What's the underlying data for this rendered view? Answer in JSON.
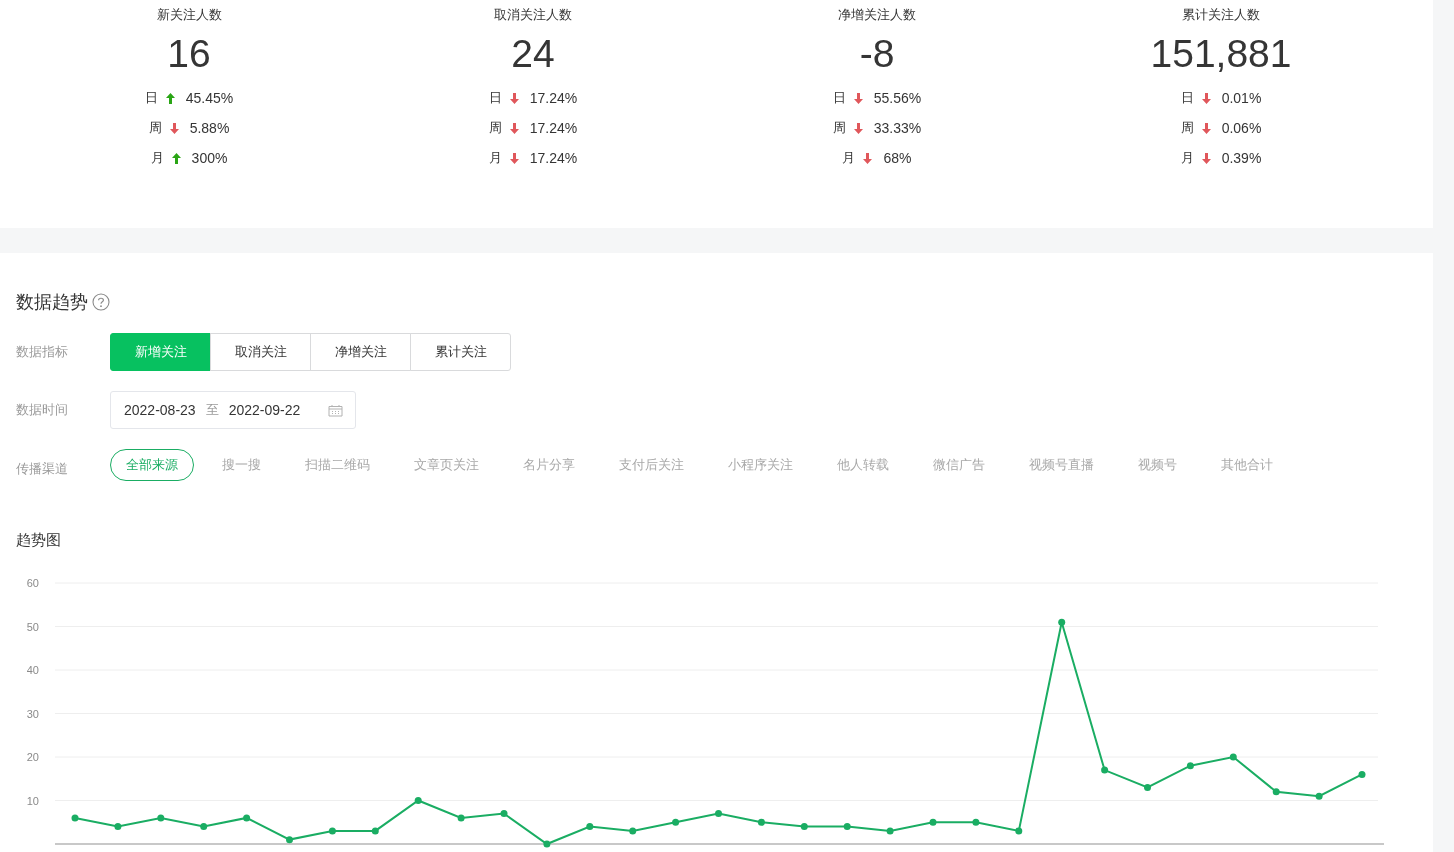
{
  "stats": [
    {
      "title": "新关注人数",
      "value": "16",
      "changes": [
        {
          "period": "日",
          "kind": "up",
          "percent": "45.45%"
        },
        {
          "period": "周",
          "kind": "down",
          "percent": "5.88%"
        },
        {
          "period": "月",
          "kind": "up",
          "percent": "300%"
        }
      ]
    },
    {
      "title": "取消关注人数",
      "value": "24",
      "changes": [
        {
          "period": "日",
          "kind": "down",
          "percent": "17.24%"
        },
        {
          "period": "周",
          "kind": "down",
          "percent": "17.24%"
        },
        {
          "period": "月",
          "kind": "down",
          "percent": "17.24%"
        }
      ]
    },
    {
      "title": "净增关注人数",
      "value": "-8",
      "changes": [
        {
          "period": "日",
          "kind": "down",
          "percent": "55.56%"
        },
        {
          "period": "周",
          "kind": "down",
          "percent": "33.33%"
        },
        {
          "period": "月",
          "kind": "down",
          "percent": "68%"
        }
      ]
    },
    {
      "title": "累计关注人数",
      "value": "151,881",
      "changes": [
        {
          "period": "日",
          "kind": "down",
          "percent": "0.01%"
        },
        {
          "period": "周",
          "kind": "down",
          "percent": "0.06%"
        },
        {
          "period": "月",
          "kind": "down",
          "percent": "0.39%"
        }
      ]
    }
  ],
  "trend": {
    "title": "数据趋势",
    "metric_label": "数据指标",
    "metrics": [
      {
        "label": "新增关注",
        "selected": true
      },
      {
        "label": "取消关注",
        "selected": false
      },
      {
        "label": "净增关注",
        "selected": false
      },
      {
        "label": "累计关注",
        "selected": false
      }
    ],
    "time_label": "数据时间",
    "date_range": {
      "start": "2022-08-23",
      "separator": "至",
      "end": "2022-09-22"
    },
    "channel_label": "传播渠道",
    "channels": [
      {
        "label": "全部来源",
        "selected": true
      },
      {
        "label": "搜一搜",
        "selected": false
      },
      {
        "label": "扫描二维码",
        "selected": false
      },
      {
        "label": "文章页关注",
        "selected": false
      },
      {
        "label": "名片分享",
        "selected": false
      },
      {
        "label": "支付后关注",
        "selected": false
      },
      {
        "label": "小程序关注",
        "selected": false
      },
      {
        "label": "他人转载",
        "selected": false
      },
      {
        "label": "微信广告",
        "selected": false
      },
      {
        "label": "视频号直播",
        "selected": false
      },
      {
        "label": "视频号",
        "selected": false
      },
      {
        "label": "其他合计",
        "selected": false
      }
    ],
    "chart_title": "趋势图",
    "chart_data": {
      "type": "line",
      "grid": true,
      "ylim": [
        0,
        60
      ],
      "yticks": [
        10,
        20,
        30,
        40,
        50,
        60
      ],
      "series": [
        {
          "color": "#1aad63",
          "marker": true,
          "values": [
            6,
            4,
            6,
            4,
            6,
            1,
            3,
            3,
            10,
            6,
            7,
            0,
            4,
            3,
            5,
            7,
            5,
            4,
            4,
            3,
            5,
            5,
            3,
            51,
            17,
            13,
            18,
            20,
            12,
            11,
            16
          ]
        }
      ]
    }
  }
}
